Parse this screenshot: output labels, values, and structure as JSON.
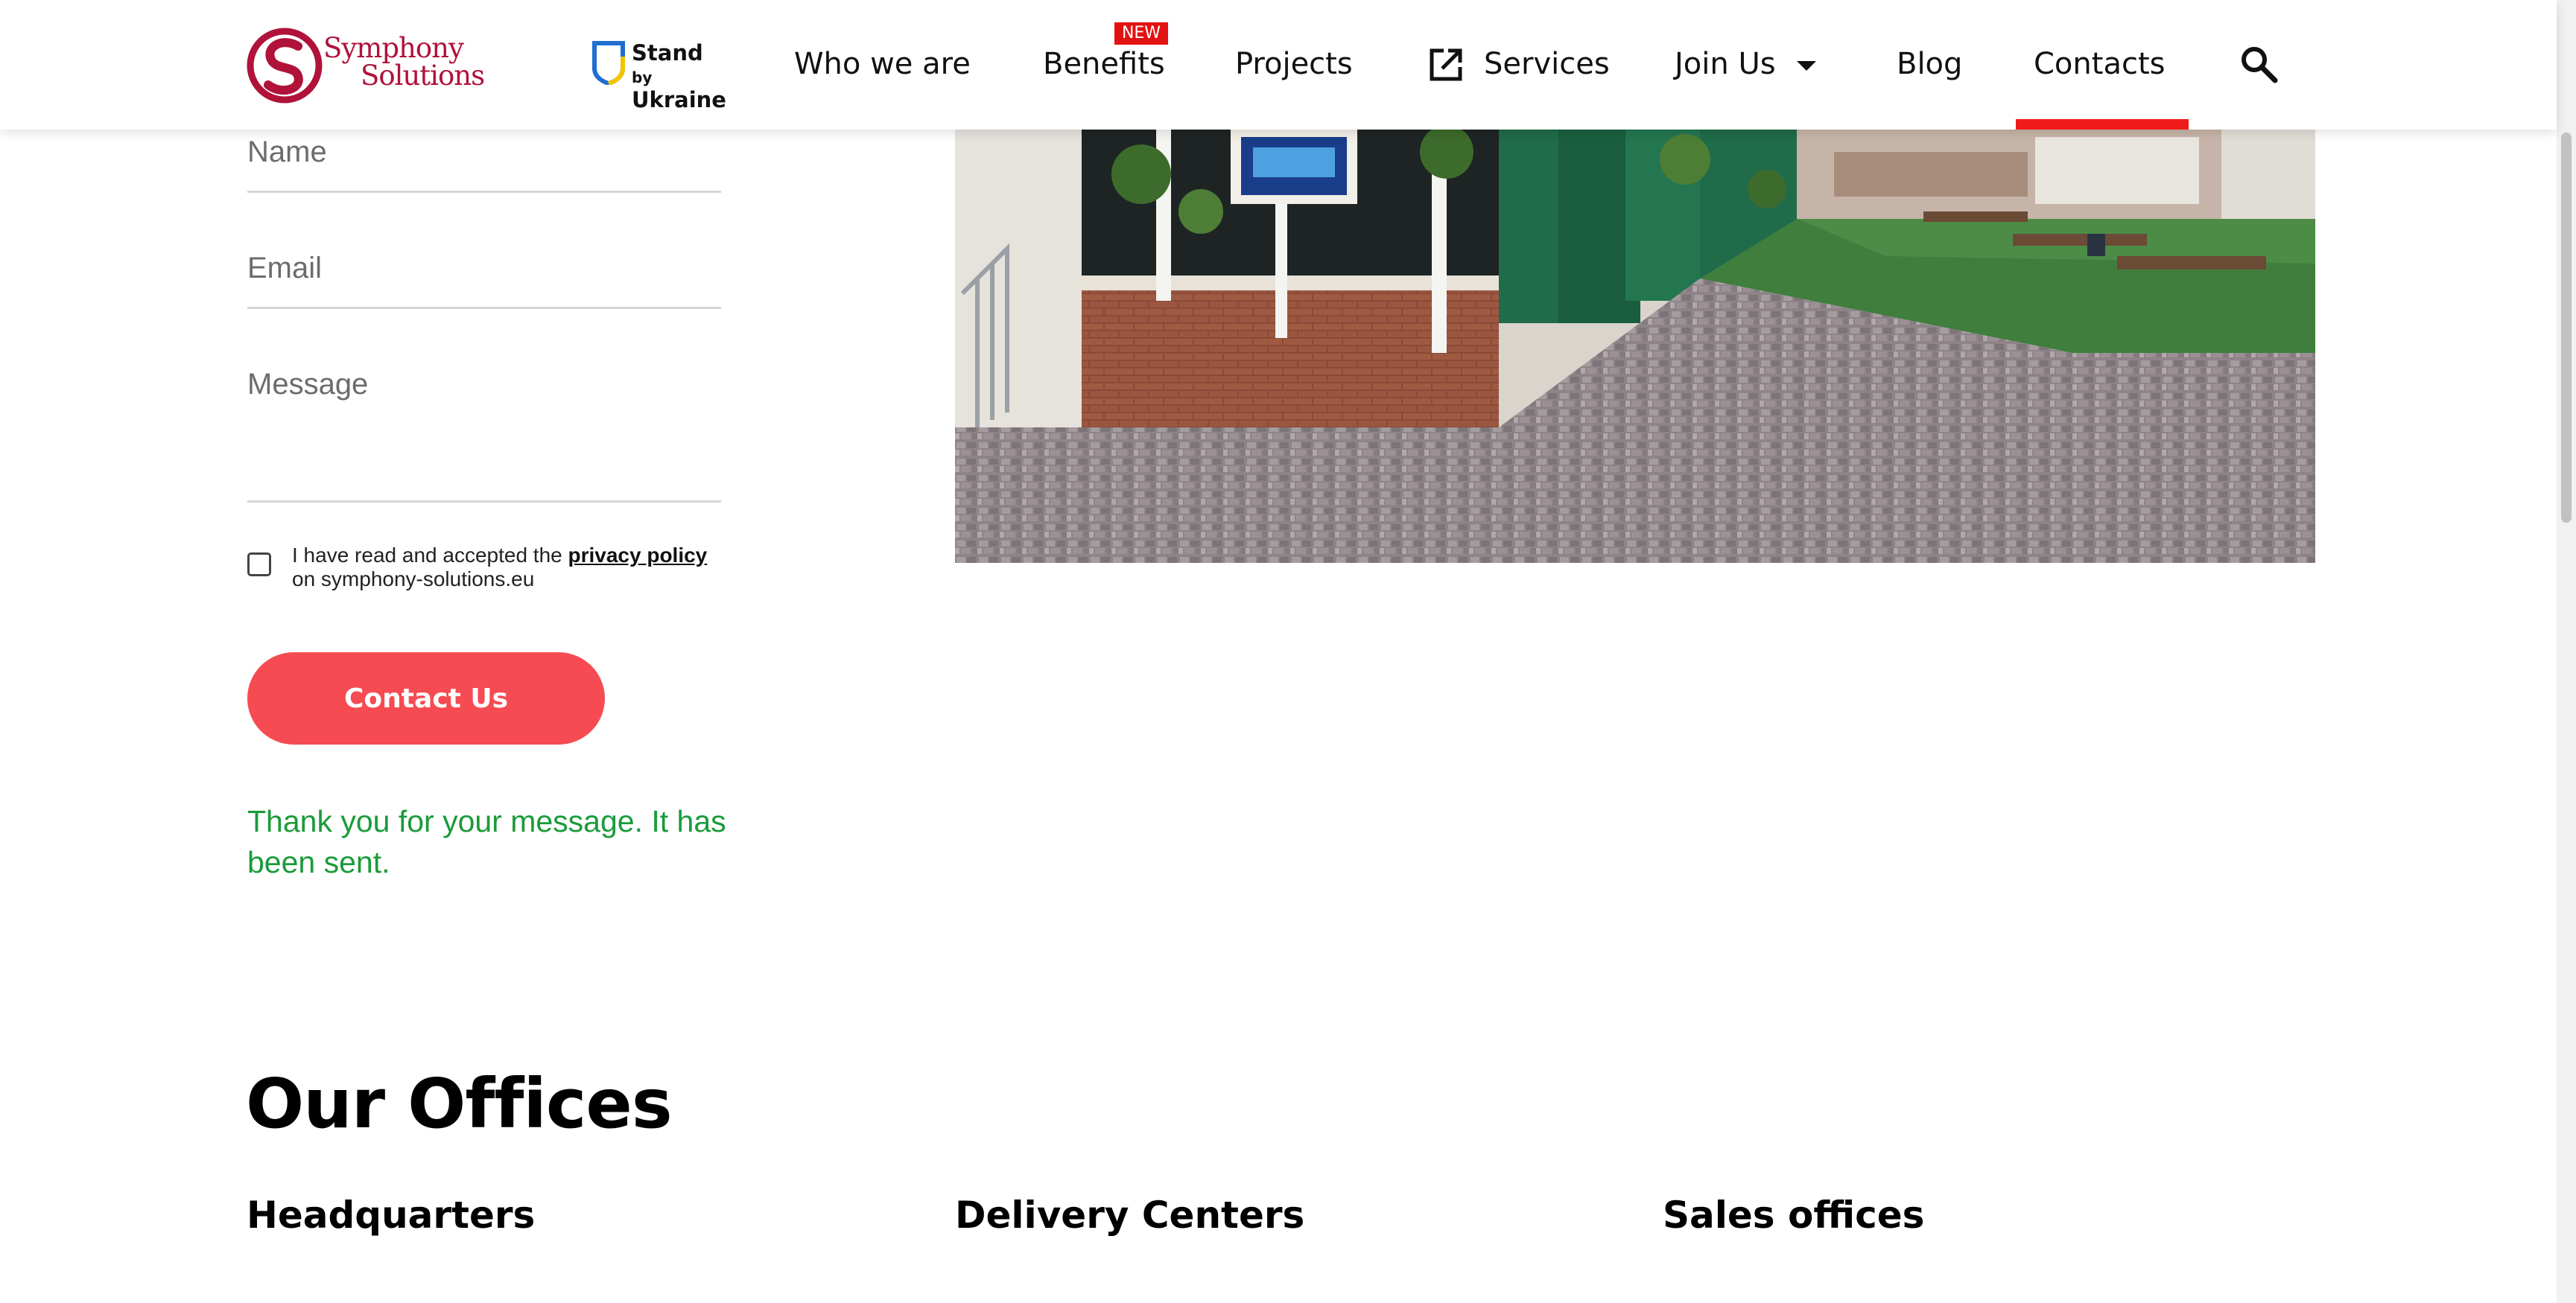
{
  "brand": {
    "logo_line1": "Symphony",
    "logo_line2": "Solutions",
    "stand_line1": "Stand",
    "stand_by": "by",
    "stand_line2": "Ukraine"
  },
  "nav": {
    "items": [
      {
        "label": "Who we are"
      },
      {
        "label": "Benefits",
        "badge": "NEW"
      },
      {
        "label": "Projects"
      },
      {
        "label": "Services",
        "icon": "external-link-icon"
      },
      {
        "label": "Join Us",
        "icon": "caret-down-icon"
      },
      {
        "label": "Blog"
      },
      {
        "label": "Contacts",
        "active": true
      }
    ],
    "search_icon": "search-icon",
    "active_color": "#f01a1a"
  },
  "form": {
    "name_placeholder": "Name",
    "email_placeholder": "Email",
    "message_placeholder": "Message",
    "consent_prefix": "I have read and accepted the ",
    "consent_link": "privacy policy",
    "consent_suffix": " on symphony-solutions.eu",
    "submit_label": "Contact Us",
    "submit_color": "#f64b52",
    "success_message": "Thank you for your message. It has been sent.",
    "success_color": "#1a9b3a"
  },
  "offices": {
    "title": "Our Offices",
    "columns": [
      {
        "heading": "Headquarters"
      },
      {
        "heading": "Delivery Centers"
      },
      {
        "heading": "Sales offices"
      }
    ]
  }
}
